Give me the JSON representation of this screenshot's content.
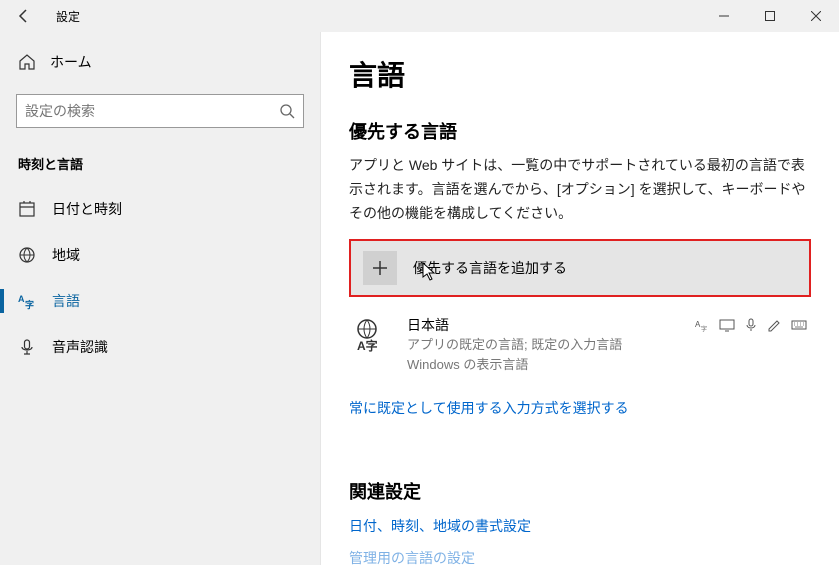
{
  "window": {
    "title": "設定"
  },
  "sidebar": {
    "home": "ホーム",
    "search_placeholder": "設定の検索",
    "section": "時刻と言語",
    "items": [
      {
        "label": "日付と時刻"
      },
      {
        "label": "地域"
      },
      {
        "label": "言語"
      },
      {
        "label": "音声認識"
      }
    ]
  },
  "main": {
    "title": "言語",
    "preferred_heading": "優先する言語",
    "preferred_desc": "アプリと Web サイトは、一覧の中でサポートされている最初の言語で表示されます。言語を選んでから、[オプション] を選択して、キーボードやその他の機能を構成してください。",
    "add_language": "優先する言語を追加する",
    "languages": [
      {
        "name": "日本語",
        "sub1": "アプリの既定の言語; 既定の入力言語",
        "sub2": "Windows の表示言語"
      }
    ],
    "default_input_link": "常に既定として使用する入力方式を選択する",
    "related_heading": "関連設定",
    "related_links": [
      "日付、時刻、地域の書式設定",
      "管理用の言語の設定"
    ]
  }
}
